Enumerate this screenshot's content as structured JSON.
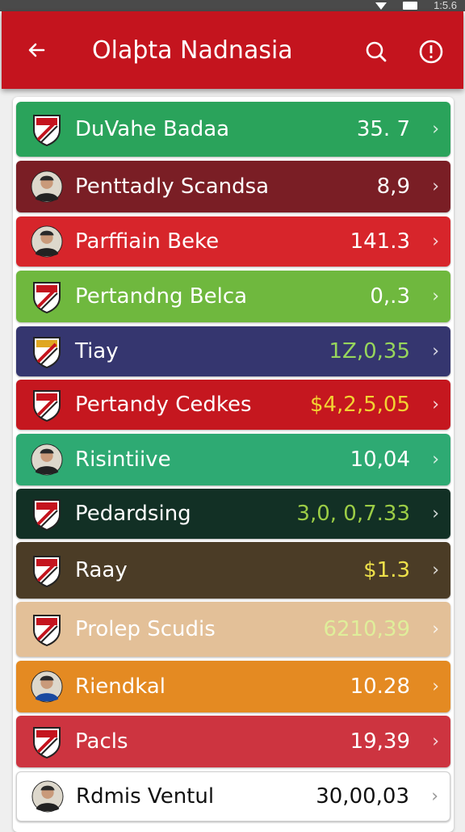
{
  "status_bar": {
    "time": "1:5.6"
  },
  "app_bar": {
    "back_icon": "arrow-left-icon",
    "title": "Olaþta Nadnasia",
    "search_icon": "search-icon",
    "info_icon": "info-icon"
  },
  "rows": [
    {
      "name": "DuVahe Badaa",
      "value": "35. 7",
      "bg": "#2aa35b",
      "value_color": "#ffffff"
    },
    {
      "name": "Penttadly Scandsa",
      "value": "8,9",
      "bg": "#7a1e25",
      "value_color": "#ffffff"
    },
    {
      "name": "Parffiain Beke",
      "value": "141.3",
      "bg": "#d7252b",
      "value_color": "#ffffff"
    },
    {
      "name": "Pertandng Belca",
      "value": "0,.3",
      "bg": "#6fb83e",
      "value_color": "#ffffff"
    },
    {
      "name": "Tiay",
      "value": "1Z,0,35",
      "bg": "#35366f",
      "value_color": "#97d65c"
    },
    {
      "name": "Pertandy Cedkes",
      "value": "$4,2,5,05",
      "bg": "#c5171f",
      "value_color": "#f2d232"
    },
    {
      "name": "Risintiive",
      "value": "10,04",
      "bg": "#2eaa73",
      "value_color": "#ffffff"
    },
    {
      "name": "Pedardsing",
      "value": "3,0, 0,7.33",
      "bg": "#123025",
      "value_color": "#9ccd46"
    },
    {
      "name": "Raay",
      "value": "$1.3",
      "bg": "#4b3c26",
      "value_color": "#ede04a"
    },
    {
      "name": "Prolep Scudis",
      "value": "6210,39",
      "bg": "#e3c098",
      "value_color": "#dfee9a"
    },
    {
      "name": "Riendkal",
      "value": "10.28",
      "bg": "#e48a22",
      "value_color": "#ffffff"
    },
    {
      "name": "Pacls",
      "value": "19,39",
      "bg": "#cd3440",
      "value_color": "#ffffff"
    },
    {
      "name": "Rdmis Ventul",
      "value": "30,00,03",
      "bg": "#ffffff",
      "value_color": "#111111",
      "name_color": "#111111"
    }
  ],
  "row_icons": {
    "crest": "club-crest-icon",
    "player": "player-avatar-icon",
    "chevron": "chevron-right-icon"
  }
}
